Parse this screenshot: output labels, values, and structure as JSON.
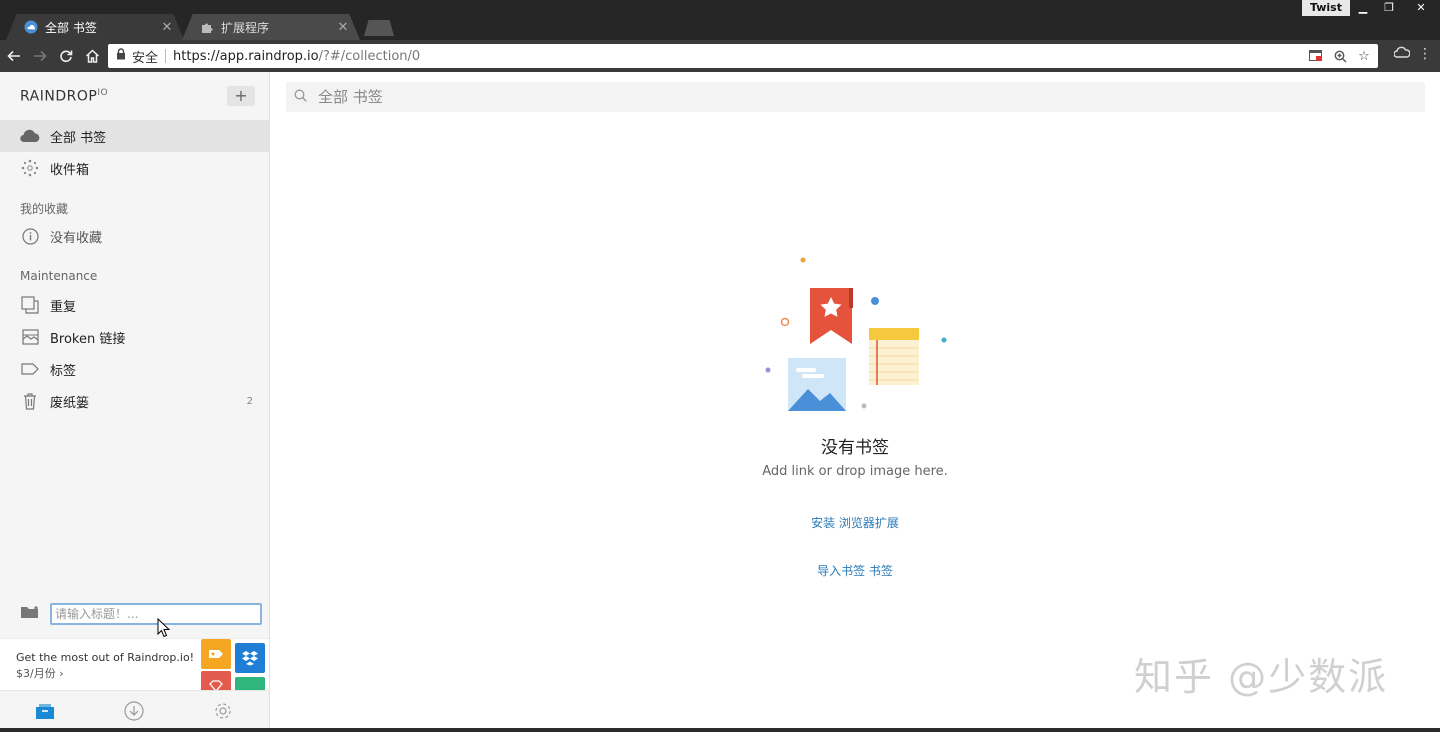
{
  "browser": {
    "tabs": [
      {
        "title": "全部 书签",
        "icon": "raindrop-cloud-icon",
        "active": true
      },
      {
        "title": "扩展程序",
        "icon": "puzzle-icon",
        "active": false
      }
    ],
    "profile_name": "Twist",
    "secure_label": "安全",
    "url_host": "https://app.raindrop.io",
    "url_path": "/?#/collection/0"
  },
  "sidebar": {
    "brand": "RAINDROP",
    "brand_suffix": "IO",
    "main_items": [
      {
        "label": "全部 书签",
        "icon": "cloud-icon",
        "active": true
      },
      {
        "label": "收件箱",
        "icon": "inbox-dots-icon",
        "active": false
      }
    ],
    "favorites_heading": "我的收藏",
    "favorites_empty": "没有收藏",
    "maintenance_heading": "Maintenance",
    "maintenance_items": [
      {
        "label": "重复",
        "icon": "duplicate-icon",
        "count": ""
      },
      {
        "label": "Broken 链接",
        "icon": "broken-image-icon",
        "count": ""
      },
      {
        "label": "标签",
        "icon": "tag-icon",
        "count": ""
      },
      {
        "label": "废纸篓",
        "icon": "trash-icon",
        "count": "2"
      }
    ],
    "new_collection_placeholder": "请输入标题！...",
    "promo_text": "Get the most out of Raindrop.io!",
    "promo_price": "$3/月份 ›"
  },
  "main": {
    "search_placeholder": "全部 书签",
    "empty_title": "没有书签",
    "empty_subtitle": "Add link or drop image here.",
    "install_link": "安装 浏览器扩展",
    "import_link": "导入书签 书签"
  },
  "watermark": "知乎 @少数派",
  "colors": {
    "accent": "#2a7ab8",
    "bookmark_red": "#e5533d",
    "promo_orange": "#f5a623",
    "promo_blue": "#1f7ed6",
    "promo_red": "#e25b4d",
    "promo_green": "#2eb67d"
  }
}
